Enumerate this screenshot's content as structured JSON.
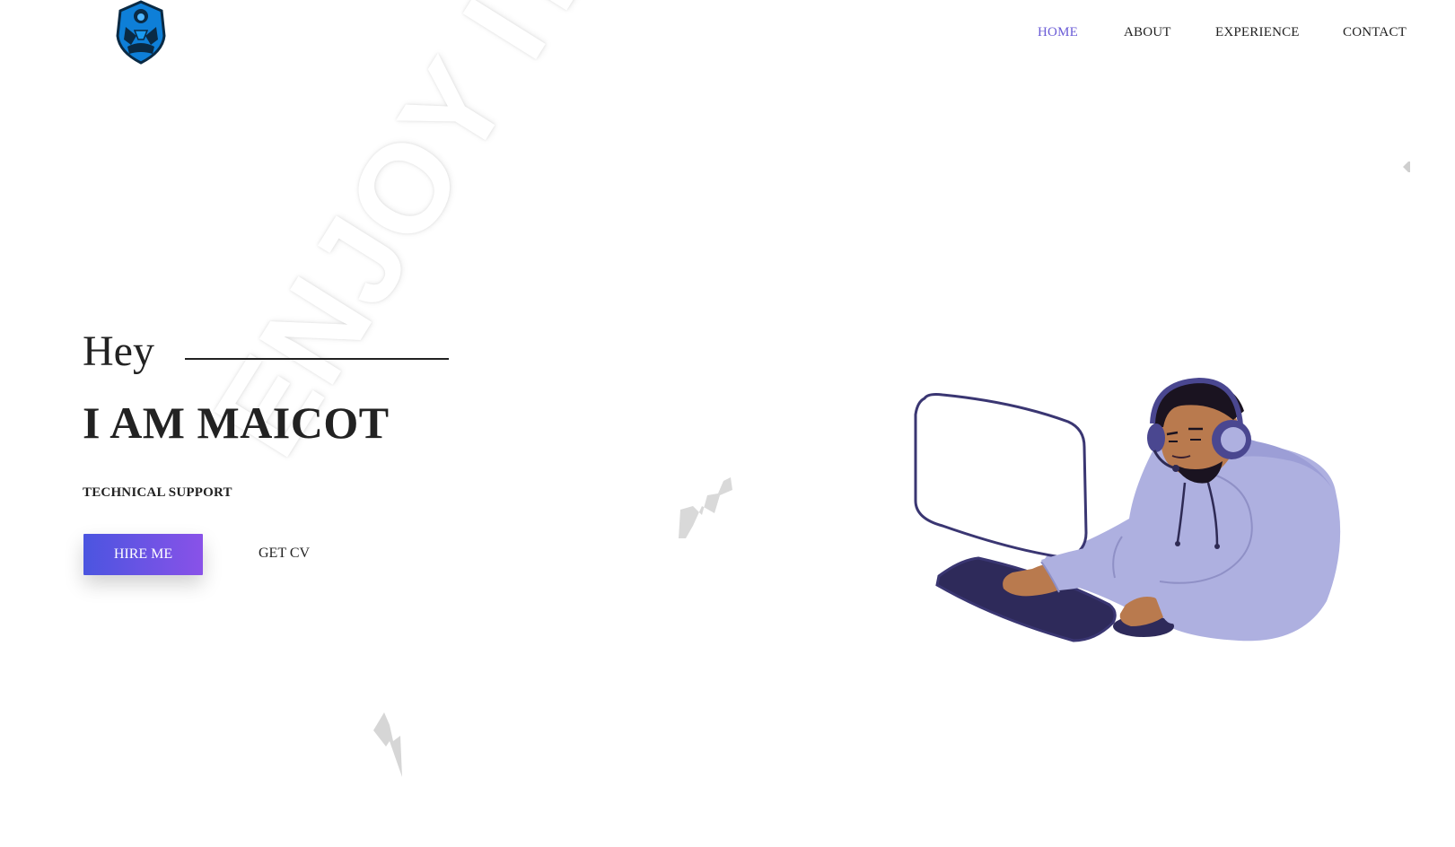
{
  "brand": {
    "logo_icon": "shield-mascot-logo"
  },
  "nav": {
    "items": [
      {
        "label": "HOME",
        "active": true
      },
      {
        "label": "ABOUT",
        "active": false
      },
      {
        "label": "EXPERIENCE",
        "active": false
      },
      {
        "label": "CONTACT",
        "active": false
      }
    ]
  },
  "hero": {
    "greeting": "Hey",
    "title": "I AM MAICOT",
    "subtitle": "TECHNICAL SUPPORT",
    "primary_button": "HIRE ME",
    "secondary_button": "GET CV",
    "watermark": "ENJOY IT"
  },
  "colors": {
    "accent": "#6a5bd6",
    "button_gradient_start": "#4b55e0",
    "button_gradient_end": "#8952e8",
    "text": "#222222"
  },
  "icons": [
    "shield-mascot-logo",
    "lightning-bolt",
    "person-at-computer-illustration"
  ]
}
